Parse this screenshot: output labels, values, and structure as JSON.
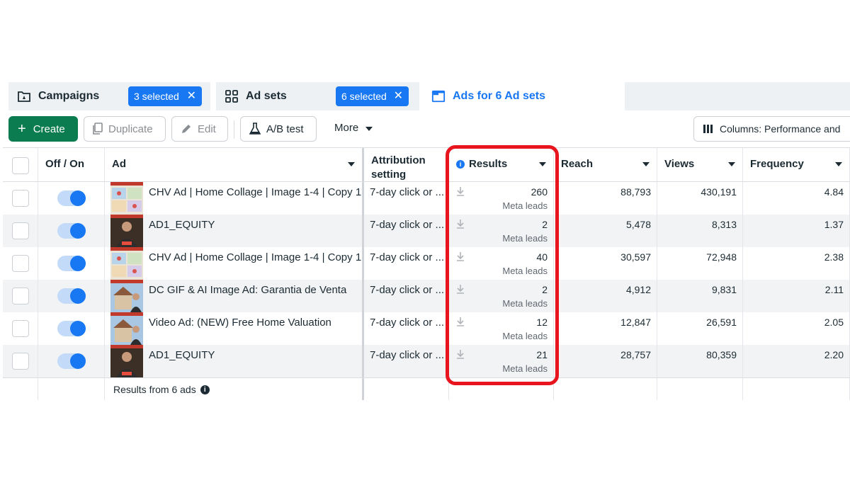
{
  "tabs": {
    "campaigns": {
      "label": "Campaigns",
      "chip": "3 selected"
    },
    "adsets": {
      "label": "Ad sets",
      "chip": "6 selected"
    },
    "ads": {
      "label": "Ads for 6 Ad sets"
    }
  },
  "toolbar": {
    "create": "Create",
    "duplicate": "Duplicate",
    "edit": "Edit",
    "ab_test": "A/B test",
    "more": "More",
    "columns": "Columns: Performance and"
  },
  "table": {
    "headers": {
      "toggle": "Off / On",
      "ad": "Ad",
      "attribution_1": "Attribution",
      "attribution_2": "setting",
      "results": "Results",
      "reach": "Reach",
      "views": "Views",
      "frequency": "Frequency"
    },
    "rows": [
      {
        "ad": "CHV Ad | Home Collage | Image 1-4 | Copy 1...",
        "attribution": "7-day click or ...",
        "results": "260",
        "results_sub": "Meta leads",
        "reach": "88,793",
        "views": "430,191",
        "frequency": "4.84",
        "thumb": "collage"
      },
      {
        "ad": "AD1_EQUITY",
        "attribution": "7-day click or ...",
        "results": "2",
        "results_sub": "Meta leads",
        "reach": "5,478",
        "views": "8,313",
        "frequency": "1.37",
        "thumb": "person"
      },
      {
        "ad": "CHV Ad | Home Collage | Image 1-4 | Copy 1...",
        "attribution": "7-day click or ...",
        "results": "40",
        "results_sub": "Meta leads",
        "reach": "30,597",
        "views": "72,948",
        "frequency": "2.38",
        "thumb": "collage"
      },
      {
        "ad": "DC GIF & AI Image Ad: Garantia de Venta",
        "attribution": "7-day click or ...",
        "results": "2",
        "results_sub": "Meta leads",
        "reach": "4,912",
        "views": "9,831",
        "frequency": "2.11",
        "thumb": "house"
      },
      {
        "ad": "Video Ad: (NEW) Free Home Valuation",
        "attribution": "7-day click or ...",
        "results": "12",
        "results_sub": "Meta leads",
        "reach": "12,847",
        "views": "26,591",
        "frequency": "2.05",
        "thumb": "house"
      },
      {
        "ad": "AD1_EQUITY",
        "attribution": "7-day click or ...",
        "results": "21",
        "results_sub": "Meta leads",
        "reach": "28,757",
        "views": "80,359",
        "frequency": "2.20",
        "thumb": "person"
      }
    ],
    "footer": "Results from 6 ads"
  },
  "colors": {
    "accent": "#1877f2",
    "create_green": "#0a7c4f",
    "highlight_red": "#e8141e"
  }
}
